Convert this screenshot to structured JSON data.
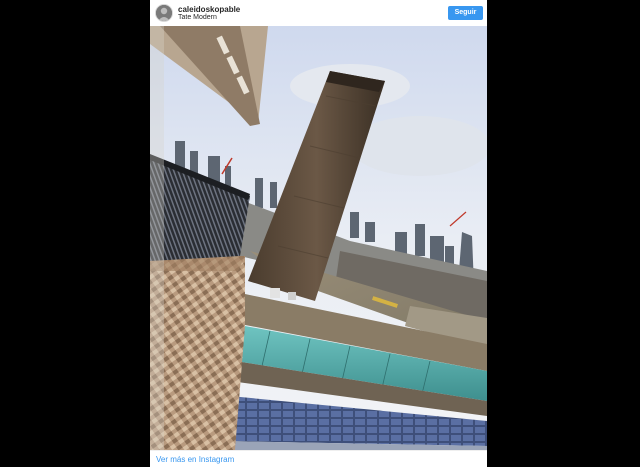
{
  "post": {
    "username": "caleidoskopable",
    "location": "Tate Modern",
    "follow_label": "Seguir",
    "more_link": "Ver más en Instagram",
    "photo_alt": "Tate Modern"
  },
  "colors": {
    "follow_button": "#3897f0",
    "link": "#3897f0",
    "text": "#262626",
    "background": "#000000"
  },
  "icons": {
    "avatar": "user-avatar"
  }
}
